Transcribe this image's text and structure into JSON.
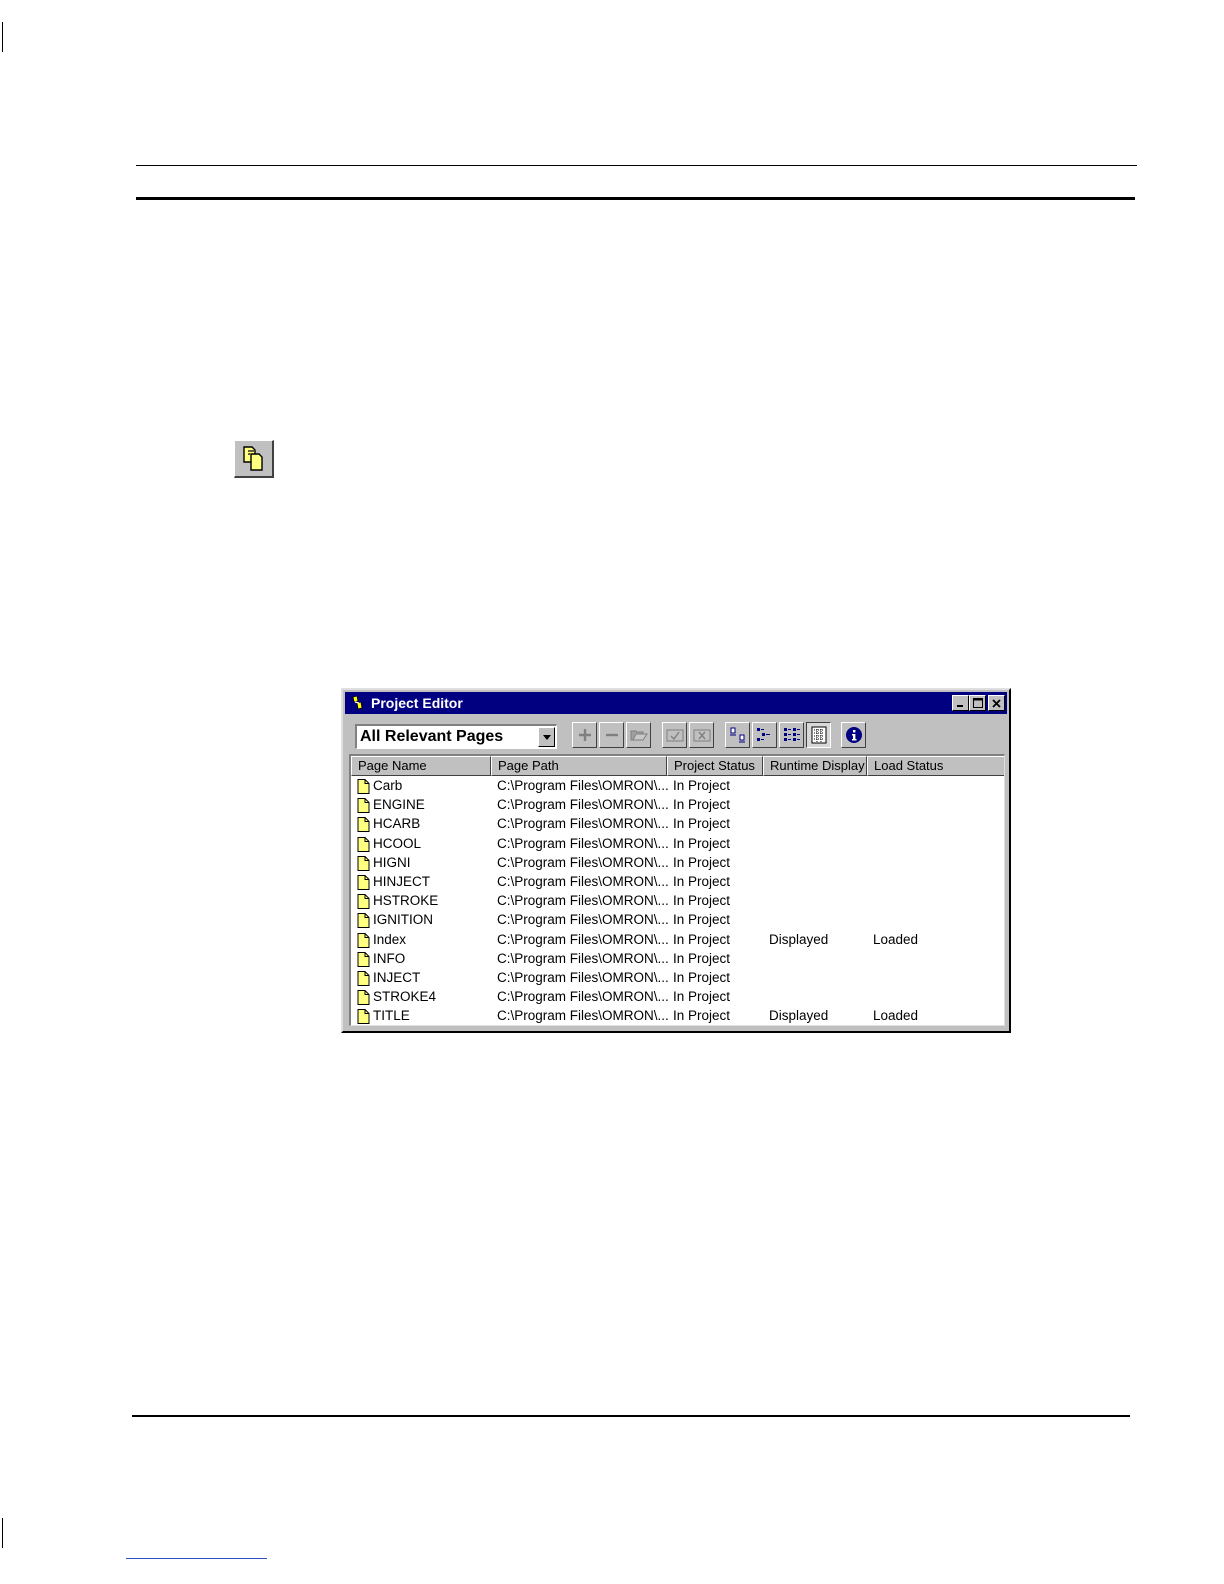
{
  "toolbar_button_icon": "pages-icon",
  "window": {
    "title": "Project Editor",
    "controls": [
      "minimize-icon",
      "maximize-icon",
      "close-icon"
    ],
    "filter_select": {
      "value": "All Relevant Pages"
    },
    "tools": [
      {
        "name": "add-icon"
      },
      {
        "name": "remove-icon"
      },
      {
        "name": "open-folder-icon"
      },
      {
        "name": "check-icon"
      },
      {
        "name": "cross-icon"
      },
      {
        "name": "large-icons-view-icon"
      },
      {
        "name": "small-icons-view-icon"
      },
      {
        "name": "list-view-icon"
      },
      {
        "name": "details-view-icon",
        "pressed": true
      },
      {
        "name": "info-icon"
      }
    ],
    "columns": [
      "Page Name",
      "Page Path",
      "Project Status",
      "Runtime Display",
      "Load Status"
    ],
    "rows": [
      {
        "name": "Carb",
        "path": "C:\\Program Files\\OMRON\\...",
        "status": "In Project",
        "display": "",
        "load": ""
      },
      {
        "name": "ENGINE",
        "path": "C:\\Program Files\\OMRON\\...",
        "status": "In Project",
        "display": "",
        "load": ""
      },
      {
        "name": "HCARB",
        "path": "C:\\Program Files\\OMRON\\...",
        "status": "In Project",
        "display": "",
        "load": ""
      },
      {
        "name": "HCOOL",
        "path": "C:\\Program Files\\OMRON\\...",
        "status": "In Project",
        "display": "",
        "load": ""
      },
      {
        "name": "HIGNI",
        "path": "C:\\Program Files\\OMRON\\...",
        "status": "In Project",
        "display": "",
        "load": ""
      },
      {
        "name": "HINJECT",
        "path": "C:\\Program Files\\OMRON\\...",
        "status": "In Project",
        "display": "",
        "load": ""
      },
      {
        "name": "HSTROKE",
        "path": "C:\\Program Files\\OMRON\\...",
        "status": "In Project",
        "display": "",
        "load": ""
      },
      {
        "name": "IGNITION",
        "path": "C:\\Program Files\\OMRON\\...",
        "status": "In Project",
        "display": "",
        "load": ""
      },
      {
        "name": "Index",
        "path": "C:\\Program Files\\OMRON\\...",
        "status": "In Project",
        "display": "Displayed",
        "load": "Loaded"
      },
      {
        "name": "INFO",
        "path": "C:\\Program Files\\OMRON\\...",
        "status": "In Project",
        "display": "",
        "load": ""
      },
      {
        "name": "INJECT",
        "path": "C:\\Program Files\\OMRON\\...",
        "status": "In Project",
        "display": "",
        "load": ""
      },
      {
        "name": "STROKE4",
        "path": "C:\\Program Files\\OMRON\\...",
        "status": "In Project",
        "display": "",
        "load": ""
      },
      {
        "name": "TITLE",
        "path": "C:\\Program Files\\OMRON\\...",
        "status": "In Project",
        "display": "Displayed",
        "load": "Loaded"
      }
    ]
  }
}
